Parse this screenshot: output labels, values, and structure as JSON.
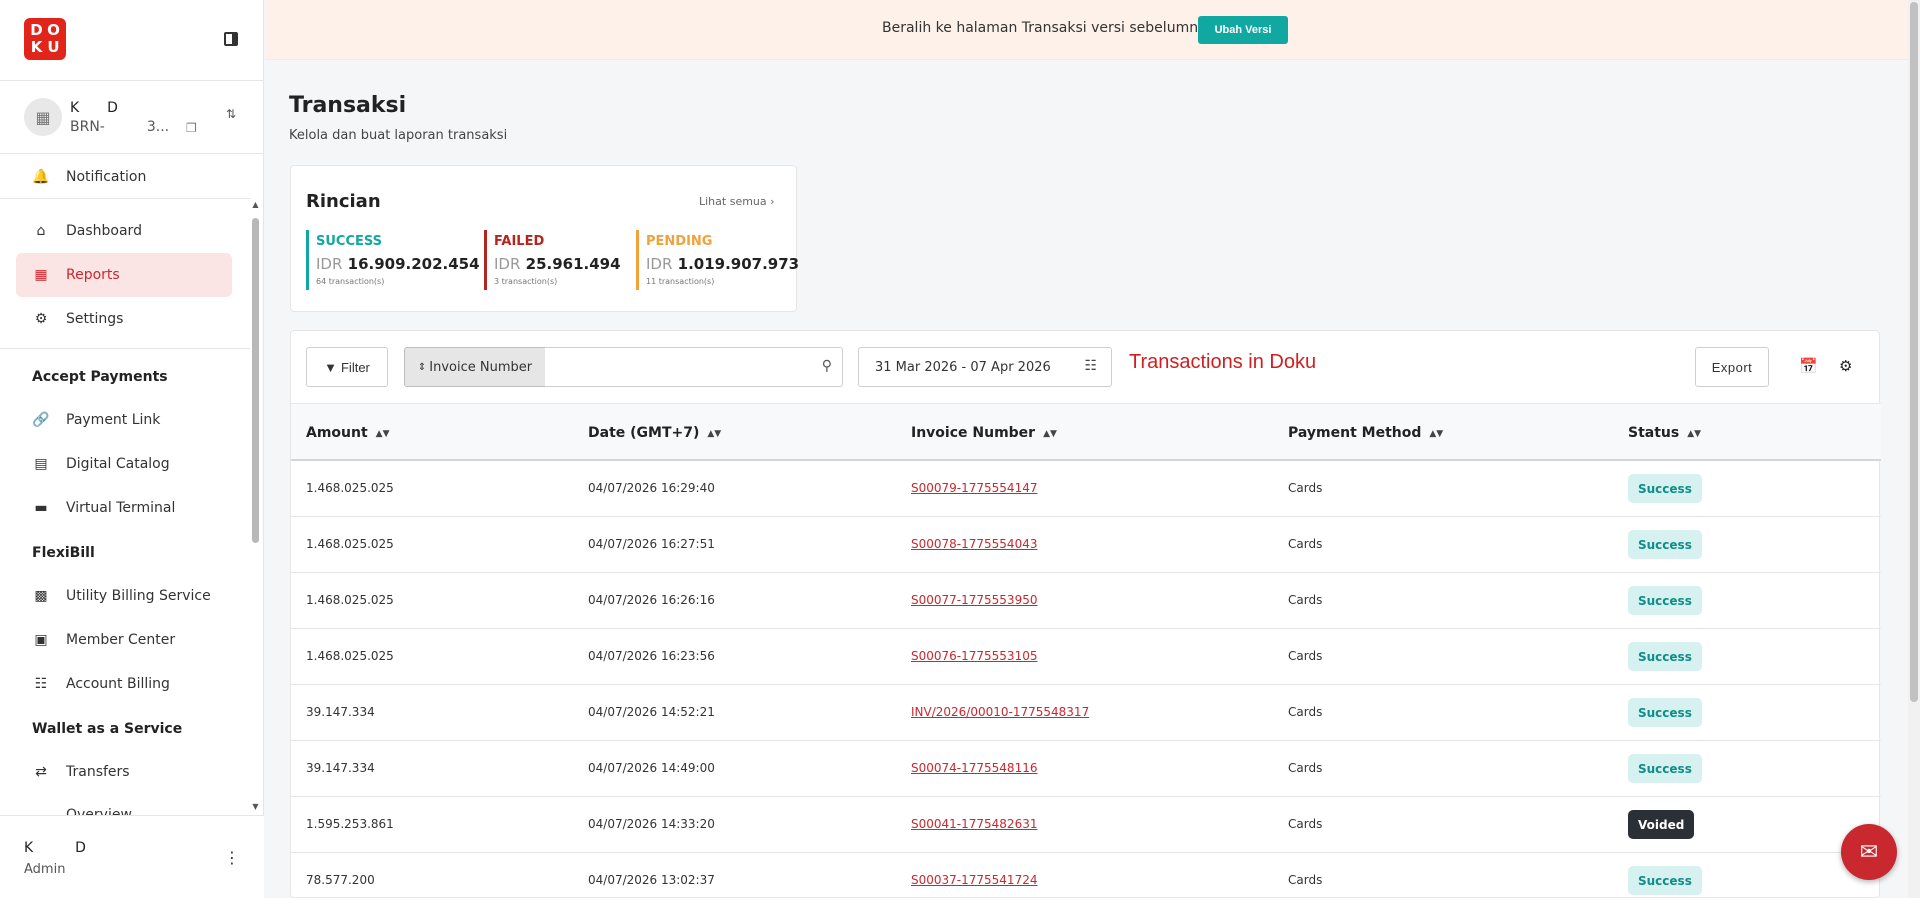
{
  "logo": {
    "letters": [
      "D",
      "O",
      "K",
      "U"
    ]
  },
  "account": {
    "name": "K  D",
    "id": "BRN-   3..."
  },
  "nav": {
    "notification": "Notification",
    "dashboard": "Dashboard",
    "reports": "Reports",
    "settings": "Settings",
    "accept_payments": "Accept Payments",
    "payment_link": "Payment Link",
    "digital_catalog": "Digital Catalog",
    "virtual_terminal": "Virtual Terminal",
    "flexibill": "FlexiBill",
    "utility_billing": "Utility Billing Service",
    "member_center": "Member Center",
    "account_billing": "Account Billing",
    "wallet_service": "Wallet as a Service",
    "transfers": "Transfers",
    "overview": "Overview"
  },
  "user": {
    "name": "K   D",
    "role": "Admin"
  },
  "banner": {
    "text": "Beralih ke halaman Transaksi versi sebelumnya?",
    "button": "Ubah Versi"
  },
  "page": {
    "title": "Transaksi",
    "subtitle": "Kelola dan buat laporan transaksi"
  },
  "rincian": {
    "title": "Rincian",
    "link": "Lihat semua",
    "success": {
      "label": "SUCCESS",
      "currency": "IDR",
      "amount": "16.909.202.454",
      "count": "64 transaction(s)",
      "color": "#10a8a0"
    },
    "failed": {
      "label": "FAILED",
      "currency": "IDR",
      "amount": "25.961.494",
      "count": "3 transaction(s)",
      "color": "#b3261e"
    },
    "pending": {
      "label": "PENDING",
      "currency": "IDR",
      "amount": "1.019.907.973",
      "count": "11 transaction(s)",
      "color": "#f0a23b"
    }
  },
  "toolbar": {
    "filter": "Filter",
    "search_by": "Invoice Number",
    "search_value": "",
    "date_range": "31 Mar 2026 - 07 Apr 2026",
    "note": "Transactions in Doku",
    "export": "Export"
  },
  "table": {
    "headers": {
      "amount": "Amount",
      "date": "Date (GMT+7)",
      "invoice": "Invoice Number",
      "method": "Payment Method",
      "status": "Status"
    },
    "rows": [
      {
        "amount": "1.468.025.025",
        "date": "04/07/2026 16:29:40",
        "invoice": "S00079-1775554147",
        "method": "Cards",
        "status": "Success"
      },
      {
        "amount": "1.468.025.025",
        "date": "04/07/2026 16:27:51",
        "invoice": "S00078-1775554043",
        "method": "Cards",
        "status": "Success"
      },
      {
        "amount": "1.468.025.025",
        "date": "04/07/2026 16:26:16",
        "invoice": "S00077-1775553950",
        "method": "Cards",
        "status": "Success"
      },
      {
        "amount": "1.468.025.025",
        "date": "04/07/2026 16:23:56",
        "invoice": "S00076-1775553105",
        "method": "Cards",
        "status": "Success"
      },
      {
        "amount": "39.147.334",
        "date": "04/07/2026 14:52:21",
        "invoice": "INV/2026/00010-1775548317",
        "method": "Cards",
        "status": "Success"
      },
      {
        "amount": "39.147.334",
        "date": "04/07/2026 14:49:00",
        "invoice": "S00074-1775548116",
        "method": "Cards",
        "status": "Success"
      },
      {
        "amount": "1.595.253.861",
        "date": "04/07/2026 14:33:20",
        "invoice": "S00041-1775482631",
        "method": "Cards",
        "status": "Voided"
      },
      {
        "amount": "78.577.200",
        "date": "04/07/2026 13:02:37",
        "invoice": "S00037-1775541724",
        "method": "Cards",
        "status": "Success"
      }
    ]
  },
  "colors": {
    "brand": "#e1251b",
    "accent": "#10a8a0",
    "link": "#c8282e"
  }
}
